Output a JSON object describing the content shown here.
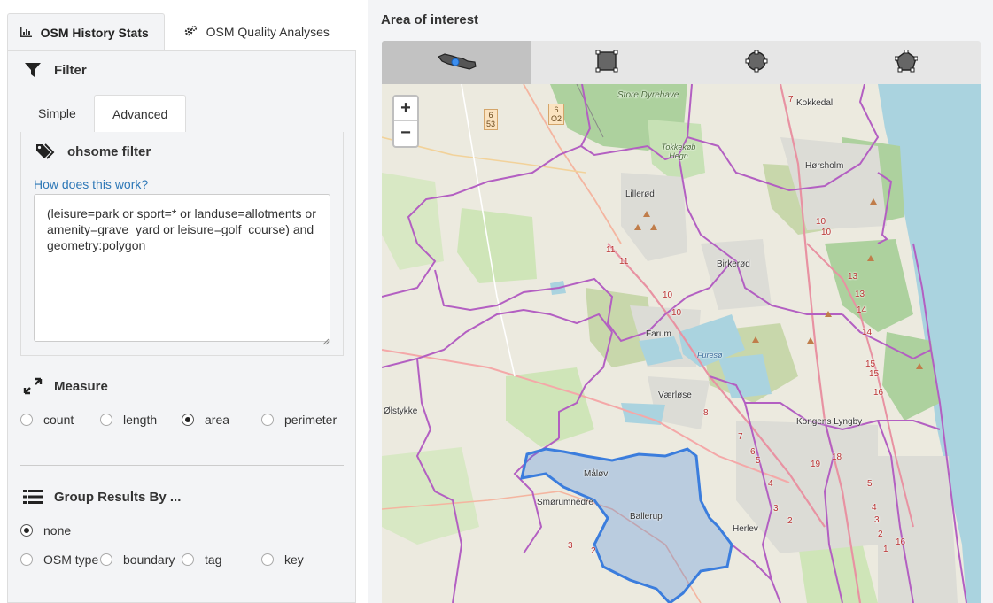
{
  "tabs": [
    {
      "label": "OSM History Stats",
      "icon": "bar-chart-icon"
    },
    {
      "label": "OSM Quality Analyses",
      "icon": "gears-icon"
    }
  ],
  "filter": {
    "title": "Filter",
    "subtabs": [
      "Simple",
      "Advanced"
    ],
    "ohsome_title": "ohsome filter",
    "how_link": "How does this work?",
    "filter_text": "(leisure=park or sport=* or landuse=allotments or amenity=grave_yard or leisure=golf_course) and geometry:polygon"
  },
  "measure": {
    "title": "Measure",
    "options": [
      "count",
      "length",
      "area",
      "perimeter"
    ],
    "selected": "area"
  },
  "group": {
    "title": "Group Results By ...",
    "options": [
      "none",
      "OSM type",
      "boundary",
      "tag",
      "key"
    ],
    "selected": "none"
  },
  "aoi": {
    "title": "Area of interest",
    "tools": [
      "country-shape-icon",
      "rectangle-icon",
      "circle-icon",
      "polygon-icon"
    ]
  },
  "map": {
    "zoom_in": "+",
    "zoom_out": "−",
    "places": [
      "Store Dyrehave",
      "Kokkedal",
      "Tokkekøb Hegn",
      "Hørsholm",
      "Lillerød",
      "Birkerød",
      "Farum",
      "Furesø",
      "Værløse",
      "Ølstykke",
      "Kongens Lyngby",
      "Måløv",
      "Smørumnedre",
      "Ballerup",
      "Herlev"
    ],
    "shields": [
      "6\n53",
      "6\nO2"
    ],
    "road_numbers": [
      "7",
      "10",
      "10",
      "11",
      "11",
      "10",
      "10",
      "13",
      "13",
      "14",
      "14",
      "15",
      "15",
      "16",
      "8",
      "7",
      "6",
      "5",
      "4",
      "3",
      "2",
      "19",
      "18",
      "5",
      "4",
      "3",
      "2",
      "1",
      "16",
      "3",
      "2"
    ]
  },
  "colors": {
    "accent": "#2e78b7",
    "selection": "#3b7ddd",
    "boundary": "#b35fc2",
    "water": "#aad3df"
  }
}
